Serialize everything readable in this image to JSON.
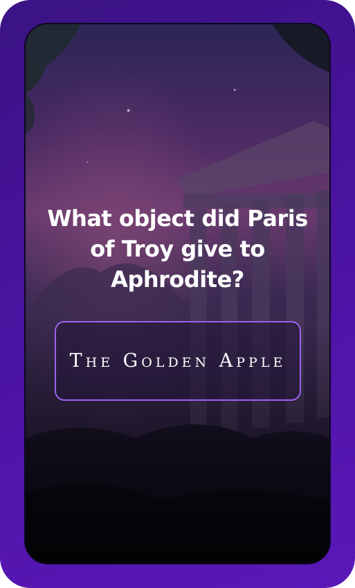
{
  "quiz": {
    "question": "What object did Paris of Troy give to Aphrodite?",
    "answer": "The Golden Apple"
  },
  "colors": {
    "frame": "#4a13a0",
    "answer_border": "#9b63ee",
    "text": "#ffffff"
  },
  "background": {
    "scene": "greek-temple-at-dusk"
  }
}
